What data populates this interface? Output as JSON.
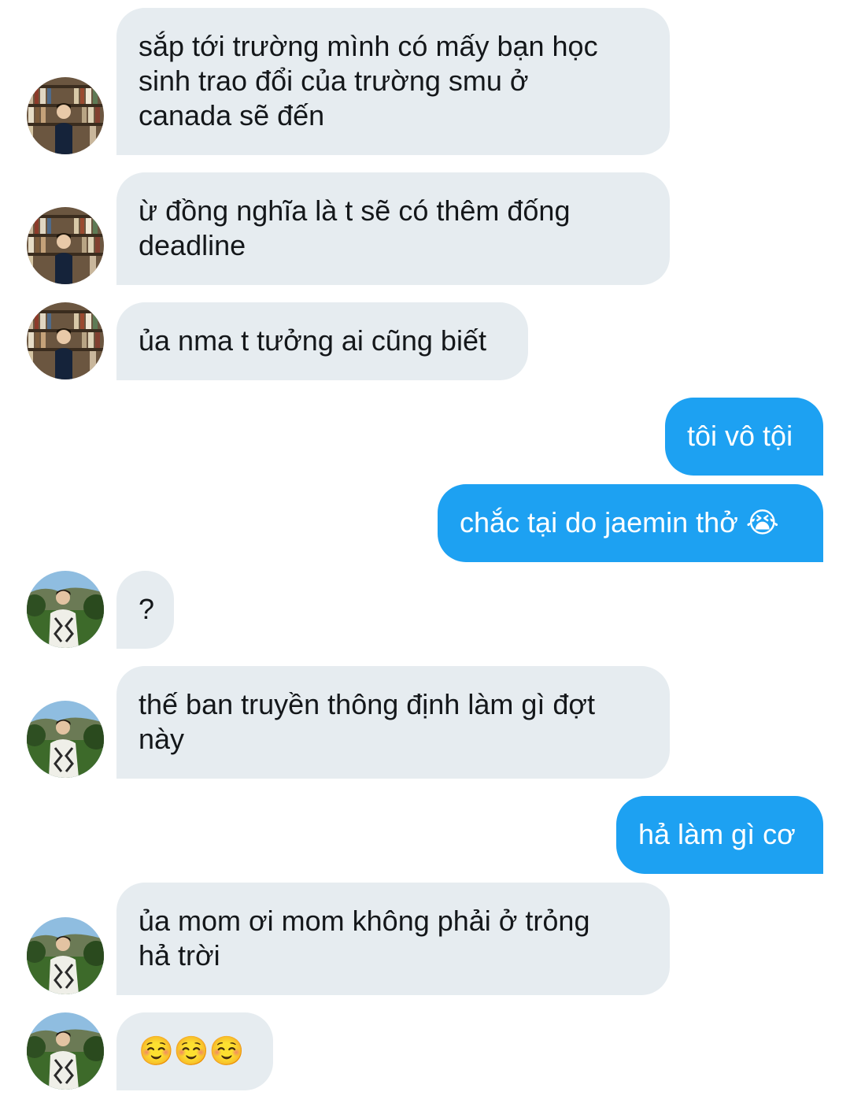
{
  "conversation": {
    "messages": [
      {
        "side": "in",
        "text": "sắp tới trường mình có mấy bạn học\nsinh trao đổi của trường smu ở\ncanada sẽ đến",
        "avatar": "library-avatar"
      },
      {
        "side": "in",
        "text": "ừ đồng nghĩa là t sẽ có thêm đống\ndeadline",
        "avatar": "library-avatar"
      },
      {
        "side": "in",
        "text": "ủa nma t tưởng ai cũng biết",
        "avatar": "library-avatar"
      },
      {
        "side": "out",
        "text": "tôi vô tội"
      },
      {
        "side": "out",
        "text": "chắc tại do jaemin thở 😭"
      },
      {
        "side": "in",
        "text": "?",
        "avatar": "outdoor-avatar"
      },
      {
        "side": "in",
        "text": "thế ban truyền thông định làm gì đợt\nnày",
        "avatar": "outdoor-avatar"
      },
      {
        "side": "out",
        "text": "hả làm gì cơ"
      },
      {
        "side": "in",
        "text": "ủa mom ơi mom không phải ở trỏng\nhả trời",
        "avatar": "outdoor-avatar"
      },
      {
        "side": "in",
        "text": "☺️☺️☺️",
        "avatar": "outdoor-avatar"
      }
    ]
  },
  "colors": {
    "incoming_bubble": "#e6ecf0",
    "outgoing_bubble": "#1da1f2",
    "incoming_text": "#14171a",
    "outgoing_text": "#ffffff"
  }
}
